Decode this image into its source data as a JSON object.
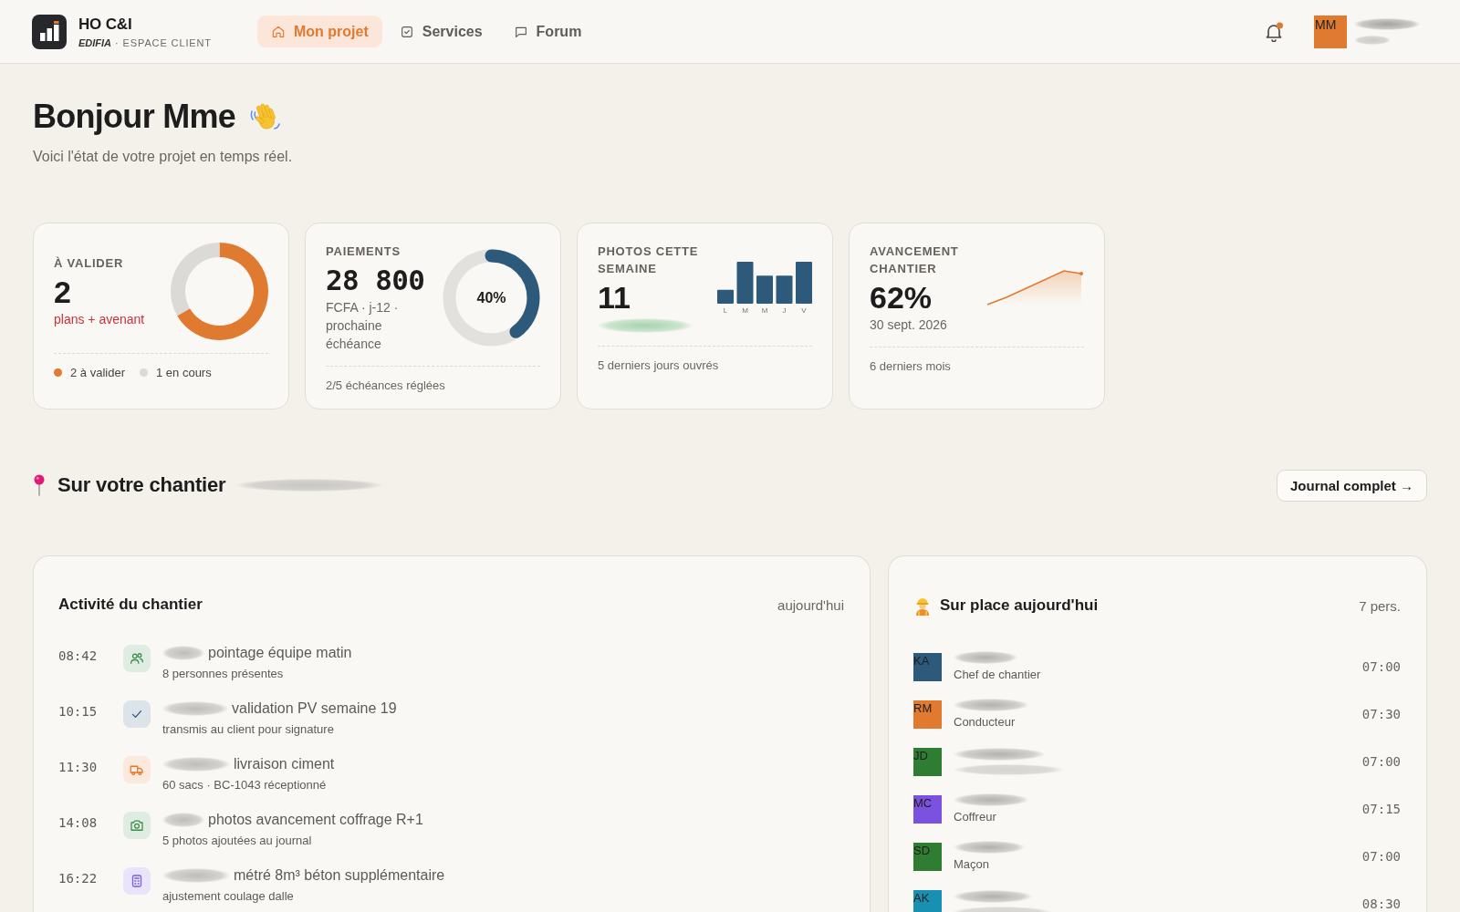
{
  "header": {
    "brand": {
      "name": "HO C&I",
      "company": "EDIFIA",
      "tagline": "· ESPACE CLIENT"
    },
    "nav": [
      {
        "label": "Mon projet",
        "selected": true
      },
      {
        "label": "Services",
        "selected": false
      },
      {
        "label": "Forum",
        "selected": false
      }
    ],
    "notifications": {
      "unread": true
    },
    "user": {
      "initials": "MM",
      "color": "#e07a30"
    }
  },
  "greeting": {
    "title": "Bonjour Mme",
    "subtitle": "Voici l'état de votre projet en temps réel."
  },
  "stats": [
    {
      "kind": "donut",
      "label": "À VALIDER",
      "value": "2",
      "note": "plans + avenant",
      "alert": true,
      "chart_data": {
        "type": "donut",
        "categories": [
          "2 à valider",
          "1 en cours"
        ],
        "values": [
          2,
          1
        ]
      },
      "legend": [
        {
          "color": "#e07a30"
        },
        {
          "color": "#dcdad6"
        }
      ]
    },
    {
      "kind": "ring",
      "label": "PAIEMENTS",
      "value": "28 800",
      "note": "FCFA · j-12 · prochaine échéance",
      "alert": false,
      "level": 0.4,
      "reading": "40%",
      "footer": "2/5 échéances réglées"
    },
    {
      "kind": "bars",
      "label": "PHOTOS CETTE SEMAINE",
      "value": "11",
      "day_labels": [
        "L",
        "M",
        "M",
        "J",
        "V"
      ],
      "footer": "5 derniers jours ouvrés"
    },
    {
      "kind": "sparkline",
      "label": "AVANCEMENT CHANTIER",
      "value": "62%",
      "note": "30 sept. 2026",
      "alert": false,
      "footer": "6 derniers mois"
    }
  ],
  "site_section": {
    "title": "Sur votre chantier",
    "action": "Journal complet →"
  },
  "activity": {
    "title": "Activité du chantier",
    "meta": "aujourd'hui",
    "items": [
      {
        "time": "08:42",
        "kind": "team",
        "color": "#dfece1",
        "text": "pointage équipe matin",
        "detail": "8 personnes présentes"
      },
      {
        "time": "10:15",
        "kind": "validation",
        "color": "#dce3e9",
        "text": "validation PV semaine 19",
        "detail": "transmis au client pour signature"
      },
      {
        "time": "11:30",
        "kind": "delivery",
        "color": "#fae9dc",
        "text": "livraison ciment",
        "detail": "60 sacs · BC-1043 réceptionné"
      },
      {
        "time": "14:08",
        "kind": "photos",
        "color": "#dfece1",
        "text": "photos avancement coffrage R+1",
        "detail": "5 photos ajoutées au journal"
      },
      {
        "time": "16:22",
        "kind": "measure",
        "color": "#e9e4fa",
        "text": "métré 8m³ béton supplémentaire",
        "detail": "ajustement coulage dalle"
      }
    ]
  },
  "onsite": {
    "title": "Sur place aujourd'hui",
    "count": "7 pers.",
    "people": [
      {
        "initials": "KA",
        "color": "#2d5a7b",
        "role": "Chef de chantier",
        "time": "07:00"
      },
      {
        "initials": "RM",
        "color": "#e07a30",
        "role": "Conducteur",
        "time": "07:30"
      },
      {
        "initials": "JD",
        "color": "#2e7d32",
        "time": "07:00"
      },
      {
        "initials": "MC",
        "color": "#7b52e0",
        "role": "Coffreur",
        "time": "07:15"
      },
      {
        "initials": "SD",
        "color": "#2e7d32",
        "role": "Maçon",
        "time": "07:00"
      },
      {
        "initials": "AK",
        "color": "#1790b2",
        "time": "08:30"
      }
    ]
  }
}
